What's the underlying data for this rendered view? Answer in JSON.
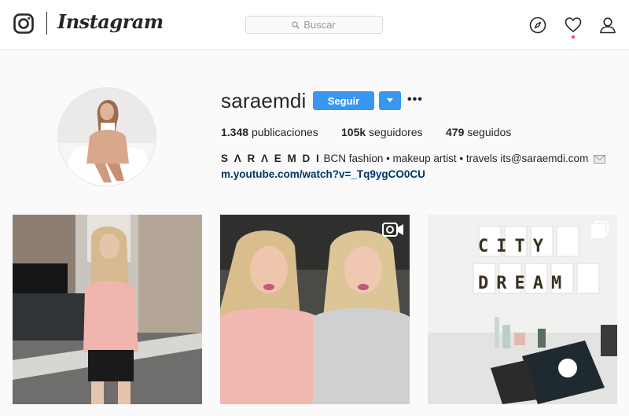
{
  "header": {
    "wordmark": "Instagram",
    "search": {
      "placeholder": "Buscar"
    },
    "icons": [
      "instagram-glyph-icon",
      "search-icon",
      "compass-icon",
      "heart-icon",
      "profile-icon"
    ],
    "notification_dot_color": "#ed4956"
  },
  "profile": {
    "username": "saraemdi",
    "follow_label": "Seguir",
    "more_label": "•••",
    "stats": {
      "posts_count": "1.348",
      "posts_label": "publicaciones",
      "followers_count": "105k",
      "followers_label": "seguidores",
      "following_count": "479",
      "following_label": "seguidos"
    },
    "bio": {
      "name": "S Λ R Λ E M D I",
      "text": "BCN fashion • makeup artist • travels its@saraemdi.com",
      "link": "m.youtube.com/watch?v=_Tq9ygCO0CU"
    }
  },
  "posts": [
    {
      "type": "image",
      "badge": ""
    },
    {
      "type": "video",
      "badge": "video-camera-icon"
    },
    {
      "type": "image",
      "badge": "carousel-icon",
      "text": "CITY DREAM"
    }
  ],
  "colors": {
    "accent": "#3897f0",
    "link": "#003569",
    "text": "#262626",
    "background": "#fafafa",
    "border": "#dbdbdb"
  }
}
